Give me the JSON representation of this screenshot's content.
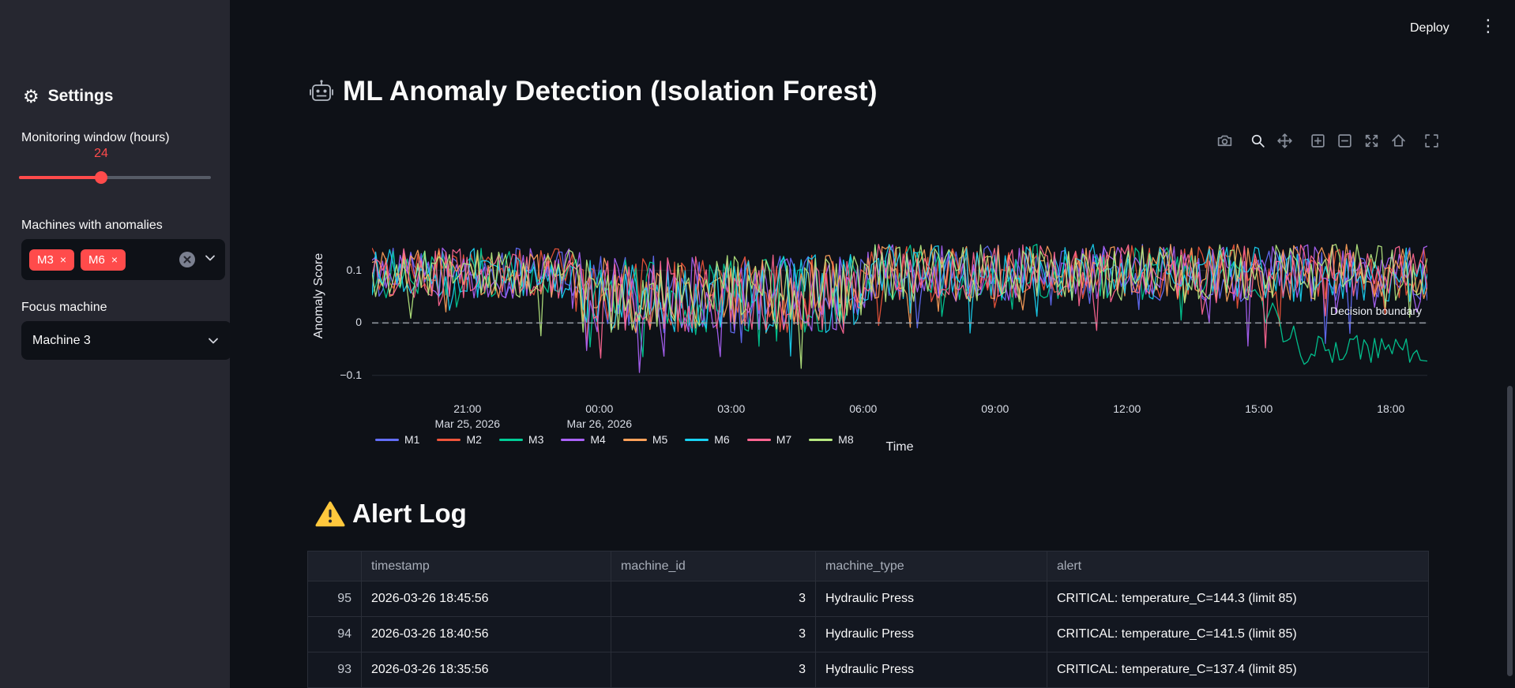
{
  "app": {
    "deploy_label": "Deploy"
  },
  "sidebar": {
    "title": "Settings",
    "monitoring": {
      "label": "Monitoring window (hours)",
      "value": "24"
    },
    "multiselect": {
      "label": "Machines with anomalies",
      "selected": [
        "M3",
        "M6"
      ]
    },
    "focus": {
      "label": "Focus machine",
      "value": "Machine 3"
    }
  },
  "main": {
    "title": "ML Anomaly Detection (Isolation Forest)",
    "alert_heading": "Alert Log"
  },
  "chart_data": {
    "type": "line",
    "title": "",
    "xlabel": "Time",
    "ylabel": "Anomaly Score",
    "x_ticks": [
      {
        "label": "21:00",
        "sub": "Mar 25, 2026"
      },
      {
        "label": "00:00",
        "sub": "Mar 26, 2026"
      },
      {
        "label": "03:00"
      },
      {
        "label": "06:00"
      },
      {
        "label": "09:00"
      },
      {
        "label": "12:00"
      },
      {
        "label": "15:00"
      },
      {
        "label": "18:00"
      }
    ],
    "first_tick_offset_hours": 2.17,
    "tick_interval_hours": 3,
    "x_range_hours": 24,
    "y_ticks": [
      {
        "label": "0.1",
        "value": 0.1
      },
      {
        "label": "0",
        "value": 0
      },
      {
        "label": "−0.1",
        "value": -0.1
      }
    ],
    "ylim": [
      -0.114,
      0.187
    ],
    "grid": true,
    "legend_position": "bottom",
    "boundary": {
      "value": 0,
      "label": "Decision boundary",
      "style": "dashed"
    },
    "series": [
      {
        "name": "M1",
        "color": "#636efa"
      },
      {
        "name": "M2",
        "color": "#ef553b"
      },
      {
        "name": "M3",
        "color": "#00cc96"
      },
      {
        "name": "M4",
        "color": "#ab63fa"
      },
      {
        "name": "M5",
        "color": "#ffa15a"
      },
      {
        "name": "M6",
        "color": "#19d3f3"
      },
      {
        "name": "M7",
        "color": "#ff6692"
      },
      {
        "name": "M8",
        "color": "#b6e880"
      }
    ],
    "points_per_series": 300,
    "envelope_segments": [
      {
        "until_hour": 4.4,
        "mean": 0.095,
        "spread": 0.048
      },
      {
        "until_hour": 10.8,
        "mean": 0.055,
        "spread": 0.075
      },
      {
        "until_hour": 24,
        "mean": 0.095,
        "spread": 0.055
      }
    ],
    "anomaly": {
      "series": "M3",
      "start_hour": 19.6,
      "settle_hour": 21.2,
      "mean": -0.05,
      "spread": 0.026
    }
  },
  "alert_table": {
    "columns": [
      "",
      "timestamp",
      "machine_id",
      "machine_type",
      "alert"
    ],
    "rows": [
      {
        "index": "95",
        "timestamp": "2026-03-26 18:45:56",
        "machine_id": "3",
        "machine_type": "Hydraulic Press",
        "alert": "CRITICAL: temperature_C=144.3 (limit 85)"
      },
      {
        "index": "94",
        "timestamp": "2026-03-26 18:40:56",
        "machine_id": "3",
        "machine_type": "Hydraulic Press",
        "alert": "CRITICAL: temperature_C=141.5 (limit 85)"
      },
      {
        "index": "93",
        "timestamp": "2026-03-26 18:35:56",
        "machine_id": "3",
        "machine_type": "Hydraulic Press",
        "alert": "CRITICAL: temperature_C=137.4 (limit 85)"
      }
    ]
  },
  "colors": {
    "accent": "#ff4b4b",
    "background": "#0e1117",
    "sidebar": "#262730",
    "boundary_line": "#9aa0a8",
    "warning": "#ffc83d"
  },
  "modebar": [
    "camera",
    "zoom",
    "pan",
    "zoom-in",
    "zoom-out",
    "autoscale",
    "reset-axes",
    "fullscreen"
  ]
}
